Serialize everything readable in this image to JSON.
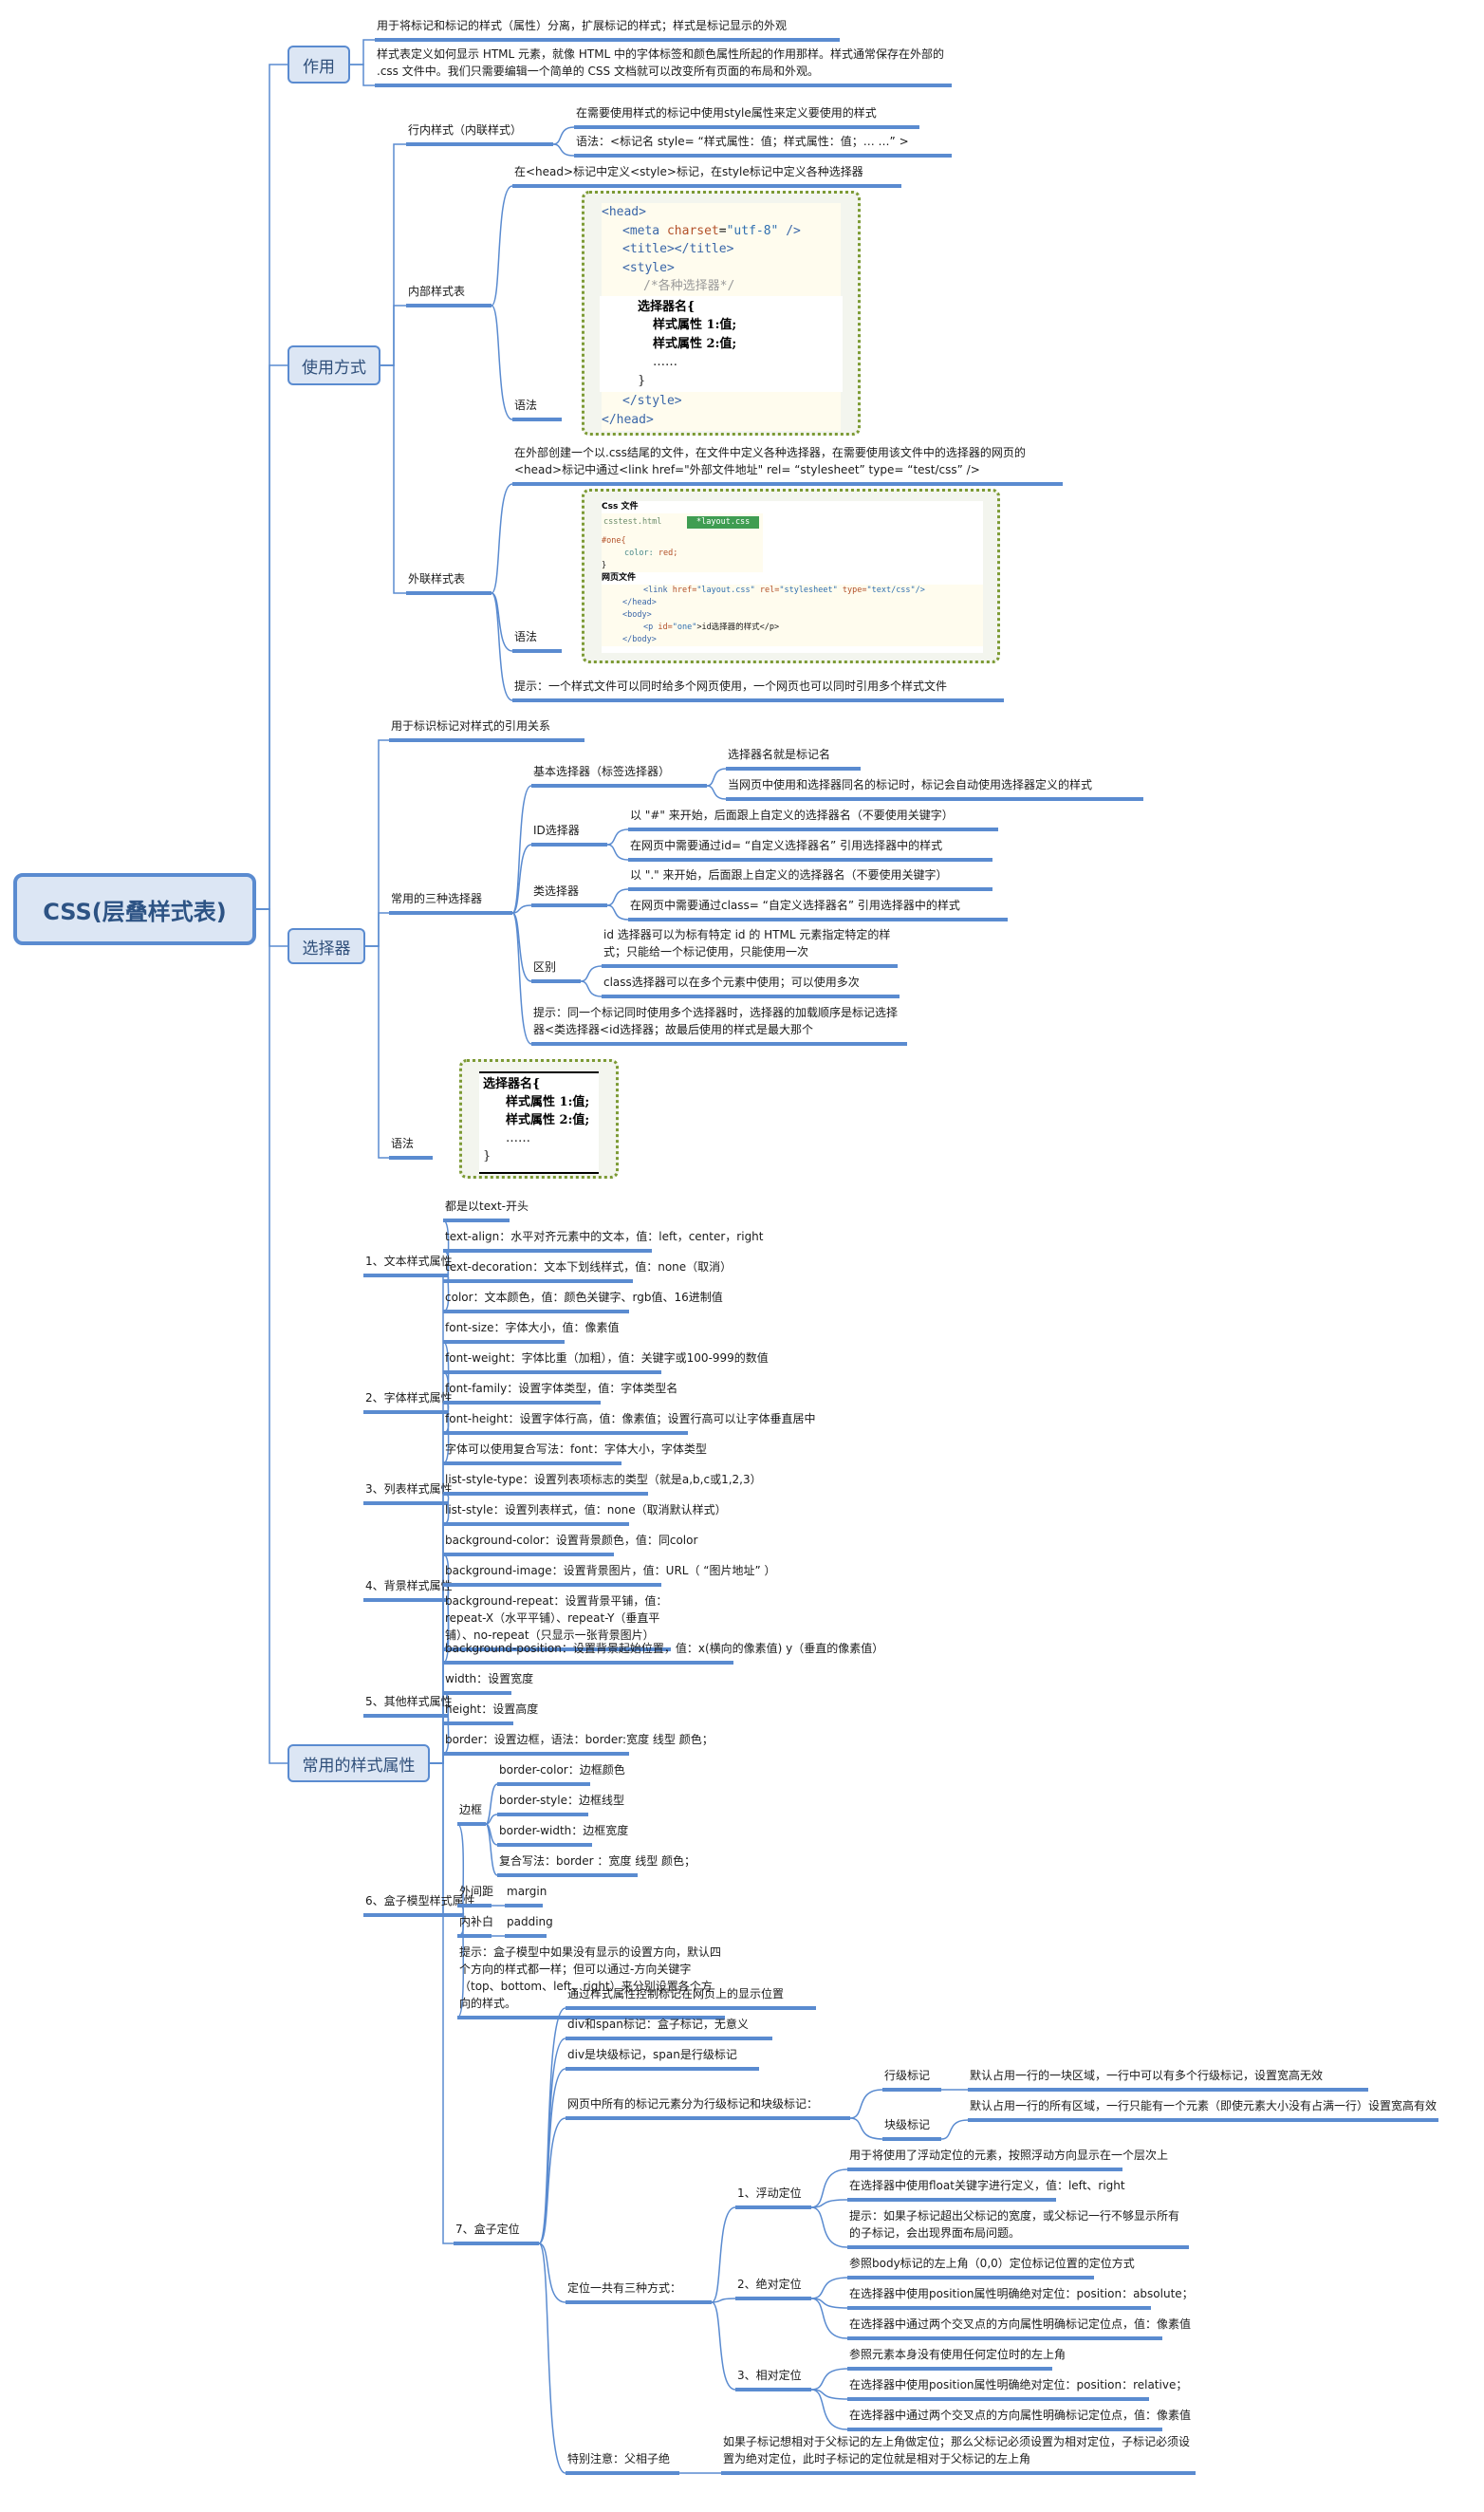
{
  "root": {
    "label": "CSS(层叠样式表)"
  },
  "purpose": {
    "label": "作用",
    "items": [
      "用于将标记和标记的样式（属性）分离，扩展标记的样式；样式是标记显示的外观",
      "样式表定义如何显示 HTML 元素，就像 HTML 中的字体标签和颜色属性所起的作用那样。样式通常保存在外部的 .css 文件中。我们只需要编辑一个简单的 CSS 文档就可以改变所有页面的布局和外观。"
    ]
  },
  "usage": {
    "label": "使用方式",
    "inline": {
      "label": "行内样式（内联样式）",
      "items": [
        "在需要使用样式的标记中使用style属性来定义要使用的样式",
        "语法：<标记名  style= “样式属性：值；样式属性：值；… …” >"
      ]
    },
    "internal": {
      "label": "内部样式表",
      "desc": "在<head>标记中定义<style>标记，在style标记中定义各种选择器",
      "syntax_label": "语法",
      "code": {
        "head_open": "<head>",
        "meta_tag": "<meta",
        "meta_attr": "charset",
        "meta_val": "\"utf-8\"",
        "meta_end": "/>",
        "title": "<title></title>",
        "style_open": "<style>",
        "comment": "/*各种选择器*/",
        "selector": "选择器名{",
        "prop1": "样式属性 1:值;",
        "prop2": "样式属性 2:值;",
        "ellipsis": "……",
        "close_brace": "}",
        "style_close": "</style>",
        "head_close": "</head>"
      }
    },
    "external": {
      "label": "外联样式表",
      "desc": "在外部创建一个以.css结尾的文件，在文件中定义各种选择器，在需要使用该文件中的选择器的网页的<head>标记中通过<link href=\"外部文件地址\" rel= “stylesheet” type= “test/css” />",
      "syntax_label": "语法",
      "code": {
        "css_file_label": "Css 文件",
        "tab_html": "csstest.html",
        "tab_css": "*layout.css",
        "rule_open": "#one{",
        "rule_prop": "color:",
        "rule_val": "red;",
        "rule_close": "}",
        "page_file_label": "网页文件",
        "link_tag": "<link",
        "link_href_attr": "href=",
        "link_href_val": "\"layout.css\"",
        "link_rel_attr": "rel=",
        "link_rel_val": "\"stylesheet\"",
        "link_type_attr": "type=",
        "link_type_val": "\"text/css\"/>",
        "head_close": "</head>",
        "body_open": "<body>",
        "p_open": "<p",
        "p_attr": "id=",
        "p_val": "\"one\"",
        "p_text": ">id选择器的样式</p>",
        "body_close": "</body>"
      },
      "tip": "提示：一个样式文件可以同时给多个网页使用，一个网页也可以同时引用多个样式文件"
    }
  },
  "selectors": {
    "label": "选择器",
    "desc": "用于标识标记对样式的引用关系",
    "three": {
      "label": "常用的三种选择器",
      "basic": {
        "label": "基本选择器（标签选择器）",
        "items": [
          "选择器名就是标记名",
          "当网页中使用和选择器同名的标记时，标记会自动使用选择器定义的样式"
        ]
      },
      "id": {
        "label": "ID选择器",
        "items": [
          "以 \"#\" 来开始，后面跟上自定义的选择器名（不要使用关键字）",
          "在网页中需要通过id= “自定义选择器名” 引用选择器中的样式"
        ]
      },
      "class": {
        "label": "类选择器",
        "items": [
          "以 \".\" 来开始，后面跟上自定义的选择器名（不要使用关键字）",
          "在网页中需要通过class= “自定义选择器名” 引用选择器中的样式"
        ]
      },
      "diff": {
        "label": "区别",
        "items": [
          "id 选择器可以为标有特定 id 的 HTML 元素指定特定的样式；只能给一个标记使用，只能使用一次",
          "class选择器可以在多个元素中使用；可以使用多次"
        ]
      },
      "tip": "提示：同一个标记同时使用多个选择器时，选择器的加载顺序是标记选择器<类选择器<id选择器；故最后使用的样式是最大那个"
    },
    "syntax": {
      "label": "语法",
      "code": {
        "selector": "选择器名{",
        "prop1": "样式属性 1:值;",
        "prop2": "样式属性 2:值;",
        "ellipsis": "……",
        "close": "}"
      }
    }
  },
  "props": {
    "label": "常用的样式属性",
    "text": {
      "label": "1、文本样式属性",
      "items": [
        "都是以text-开头",
        "text-align：水平对齐元素中的文本，值：left，center，right",
        "text-decoration：文本下划线样式，值：none（取消）",
        "color：文本颜色，值：颜色关键字、rgb值、16进制值"
      ]
    },
    "font": {
      "label": "2、字体样式属性",
      "items": [
        "font-size：字体大小，值：像素值",
        "font-weight：字体比重（加粗），值：关键字或100-999的数值",
        "font-family：设置字体类型，值：字体类型名",
        "font-height：设置字体行高，值：像素值；设置行高可以让字体垂直居中",
        "字体可以使用复合写法：font：字体大小，字体类型"
      ]
    },
    "list": {
      "label": "3、列表样式属性",
      "items": [
        "list-style-type：设置列表项标志的类型（就是a,b,c或1,2,3）",
        "list-style：设置列表样式，值：none（取消默认样式）"
      ]
    },
    "bg": {
      "label": "4、背景样式属性",
      "items": [
        "background-color：设置背景颜色，值：同color",
        "background-image：设置背景图片，值：URL（ “图片地址” ）",
        "background-repeat：设置背景平铺，值：repeat-X（水平平铺）、repeat-Y（垂直平铺）、no-repeat（只显示一张背景图片）",
        "background-position：设置背景起始位置，值：x(横向的像素值)  y（垂直的像素值）"
      ]
    },
    "other": {
      "label": "5、其他样式属性",
      "items": [
        "width：设置宽度",
        "height：设置高度",
        "border：设置边框，语法：border:宽度  线型  颜色；"
      ]
    },
    "box": {
      "label": "6、盒子模型样式属性",
      "border": {
        "label": "边框",
        "items": [
          "border-color：边框颜色",
          "border-style：边框线型",
          "border-width：边框宽度",
          "复合写法：border ：宽度  线型  颜色；"
        ]
      },
      "margin": {
        "label": "外间距",
        "value": "margin"
      },
      "padding": {
        "label": "内补白",
        "value": "padding"
      },
      "tip": "提示：盒子模型中如果没有显示的设置方向，默认四个方向的样式都一样；但可以通过-方向关键字（top、bottom、left、right）来分别设置各个方向的样式。"
    },
    "position": {
      "label": "7、盒子定位",
      "items": [
        "通过样式属性控制标记在网页上的显示位置",
        "div和span标记：盒子标记，无意义",
        "div是块级标记，span是行级标记"
      ],
      "elements": {
        "label": "网页中所有的标记元素分为行级标记和块级标记：",
        "inline": {
          "label": "行级标记",
          "desc": "默认占用一行的一块区域，一行中可以有多个行级标记，设置宽高无效"
        },
        "block": {
          "label": "块级标记",
          "desc": "默认占用一行的所有区域，一行只能有一个元素（即使元素大小没有占满一行）设置宽高有效"
        }
      },
      "modes": {
        "label": "定位一共有三种方式：",
        "float": {
          "label": "1、浮动定位",
          "items": [
            "用于将使用了浮动定位的元素，按照浮动方向显示在一个层次上",
            "在选择器中使用float关键字进行定义，值：left、right",
            "提示：如果子标记超出父标记的宽度，或父标记一行不够显示所有的子标记，会出现界面布局问题。"
          ]
        },
        "absolute": {
          "label": "2、绝对定位",
          "items": [
            "参照body标记的左上角（0,0）定位标记位置的定位方式",
            "在选择器中使用position属性明确绝对定位：position：absolute；",
            "在选择器中通过两个交叉点的方向属性明确标记定位点，值：像素值"
          ]
        },
        "relative": {
          "label": "3、相对定位",
          "items": [
            "参照元素本身没有使用任何定位时的左上角",
            "在选择器中使用position属性明确绝对定位：position：relative；",
            "在选择器中通过两个交叉点的方向属性明确标记定位点，值：像素值"
          ]
        }
      },
      "note": {
        "label": "特别注意：父相子绝",
        "desc": "如果子标记想相对于父标记的左上角做定位；那么父标记必须设置为相对定位，子标记必须设置为绝对定位，此时子标记的定位就是相对于父标记的左上角"
      }
    }
  },
  "colors": {
    "line": "#5a8bd0",
    "node_fill": "#dce6f4",
    "code_border": "#7c9a34"
  }
}
